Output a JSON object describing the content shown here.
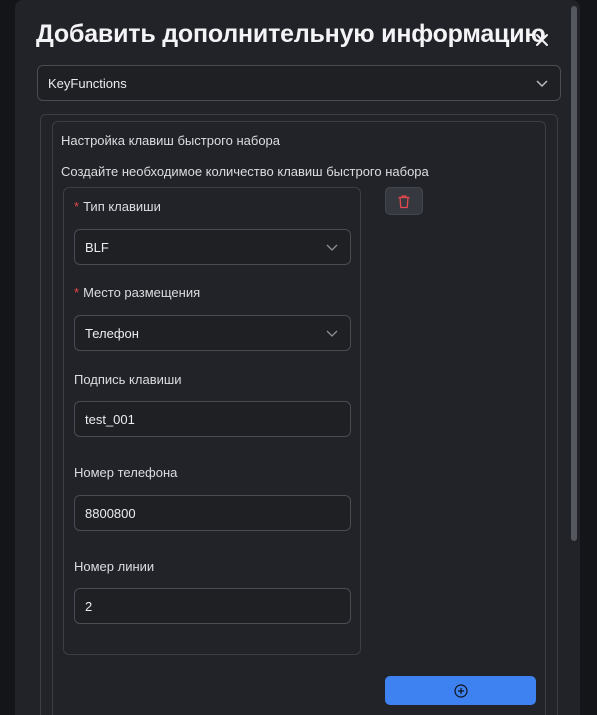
{
  "dialog": {
    "title": "Добавить дополнительную информацию",
    "close_icon": "close-icon",
    "type_select": {
      "value": "KeyFunctions",
      "icon": "chevron-down-icon"
    }
  },
  "section": {
    "title": "Настройка клавиш быстрого набора",
    "description": "Создайте необходимое количество клавиш быстрого набора"
  },
  "key_card": {
    "key_type": {
      "required_mark": "*",
      "label": "Тип клавиши",
      "value": "BLF"
    },
    "placement": {
      "required_mark": "*",
      "label": "Место размещения",
      "value": "Телефон"
    },
    "caption": {
      "label": "Подпись клавиши",
      "value": "test_001"
    },
    "phone": {
      "label": "Номер телефона",
      "value": "8800800"
    },
    "line": {
      "label": "Номер линии",
      "value": "2"
    },
    "delete_icon": "trash-icon"
  },
  "add_button": {
    "icon": "plus-circle-icon"
  },
  "colors": {
    "background": "#222328",
    "accent": "#3d82f0",
    "danger": "#e5484d",
    "border": "#4a4c53"
  }
}
